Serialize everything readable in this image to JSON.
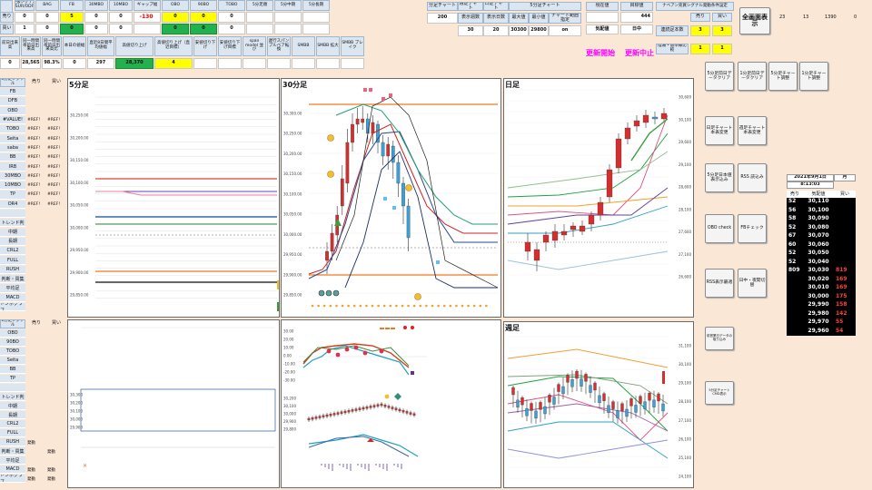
{
  "top_headers": [
    {
      "label": "逆張シグナル（SUR/ODF）",
      "value": "0",
      "hl": "val"
    },
    {
      "label": "BAG",
      "value": "0",
      "hl": "val"
    },
    {
      "label": "FB",
      "value": "5",
      "hl": "yel"
    },
    {
      "label": "30MBO",
      "value": "0",
      "hl": "val"
    },
    {
      "label": "10MBO",
      "value": "0",
      "hl": "val"
    },
    {
      "label": "ギャップ幅",
      "value": "-130",
      "hl": "red"
    },
    {
      "label": "OBO",
      "value": "0",
      "hl": "yel"
    },
    {
      "label": "90BO",
      "value": "0",
      "hl": "yel"
    },
    {
      "label": "TOBO",
      "value": "0",
      "hl": "val"
    },
    {
      "label": "5分足順",
      "value": "",
      "hl": "val"
    },
    {
      "label": "5分中期",
      "value": "",
      "hl": "val"
    },
    {
      "label": "5分長期",
      "value": "",
      "hl": "val"
    }
  ],
  "row1": {
    "label": "売り",
    "values": [
      "0",
      "0",
      "5",
      "0",
      "0",
      "",
      "0",
      "0",
      "0",
      "",
      "",
      ""
    ]
  },
  "row2": {
    "label": "買い",
    "values": [
      "1",
      "0",
      "0",
      "0",
      "0",
      "",
      "0",
      "0",
      "0",
      "",
      "",
      ""
    ]
  },
  "row3": [
    {
      "label": "前日出来高",
      "value": "0"
    },
    {
      "label": "同一時間帯前日出来高",
      "value": "28,565"
    },
    {
      "label": "同一時間帯前日出来高比",
      "value": "98.3%"
    },
    {
      "label": "本日の値幅",
      "value": "0"
    },
    {
      "label": "直近8日間平均値幅",
      "value": "297"
    },
    {
      "label": "高値切り上げ",
      "value": "28,370"
    },
    {
      "label": "高値切り上げ（直近目標）",
      "value": "4"
    },
    {
      "label": "安値切り下げ",
      "value": ""
    },
    {
      "label": "安値切り下げ目標",
      "value": ""
    },
    {
      "label": "span model 並び",
      "value": ""
    },
    {
      "label": "遅行スパン ブルベア転換",
      "value": ""
    },
    {
      "label": "SMBB",
      "value": ""
    },
    {
      "label": "SMBB 拡大",
      "value": ""
    },
    {
      "label": "SMBB ブレイク",
      "value": ""
    }
  ],
  "chart_settings": {
    "headers": [
      "分足チャート",
      "週足チャート",
      "日足チャート",
      "",
      "5分足チャート"
    ],
    "row1": [
      "200",
      "表示週数",
      "表示日数",
      "最大値",
      "最小値",
      "チャート範囲指定"
    ],
    "row2": [
      "",
      "30",
      "20",
      "30300",
      "29800",
      "on"
    ]
  },
  "status": {
    "current_price_label": "現在値",
    "current_price": "",
    "target_label": "目標値",
    "target": "444",
    "mode_label": "気配値",
    "session_label": "日中"
  },
  "signal_settings": {
    "title": "ナベアン売買シグナル発動条件設定",
    "cols": [
      "売り",
      "買い"
    ],
    "rows": [
      {
        "label": "連続足本数",
        "sell": "3",
        "buy": "3"
      },
      {
        "label": "陰陽・基準線比較",
        "sell": "1",
        "buy": "1"
      }
    ]
  },
  "update_buttons": {
    "start": "更新開始",
    "stop": "更新中止"
  },
  "full_screen": "全画面表示",
  "top_right_values": [
    "23",
    "13",
    "1390",
    "0"
  ],
  "left_list1": {
    "title": "5分足シグナル",
    "cols": [
      "売り",
      "買い"
    ],
    "rows": [
      {
        "label": "FB",
        "sell": "",
        "buy": ""
      },
      {
        "label": "DFB",
        "sell": "",
        "buy": ""
      },
      {
        "label": "OBO",
        "sell": "",
        "buy": ""
      },
      {
        "label": "#VALUE!",
        "sell": "#REF!",
        "buy": "#REF!"
      },
      {
        "label": "TOBO",
        "sell": "#REF!",
        "buy": "#REF!"
      },
      {
        "label": "Seita",
        "sell": "#REF!",
        "buy": "#REF!"
      },
      {
        "label": "saba",
        "sell": "#REF!",
        "buy": "#REF!"
      },
      {
        "label": "BB",
        "sell": "#REF!",
        "buy": "#REF!"
      },
      {
        "label": "IRB",
        "sell": "#REF!",
        "buy": "#REF!"
      },
      {
        "label": "30MBO",
        "sell": "#REF!",
        "buy": "#REF!"
      },
      {
        "label": "10MBO",
        "sell": "#REF!",
        "buy": "#REF!"
      },
      {
        "label": "TP",
        "sell": "#REF!",
        "buy": "#REF!"
      },
      {
        "label": "OR4",
        "sell": "#REF!",
        "buy": "#REF!"
      },
      {
        "label": "",
        "sell": "",
        "buy": ""
      },
      {
        "label": "トレンド判",
        "sell": "",
        "buy": ""
      },
      {
        "label": "中期",
        "sell": "",
        "buy": ""
      },
      {
        "label": "長期",
        "sell": "",
        "buy": ""
      },
      {
        "label": "CRL2",
        "sell": "",
        "buy": ""
      },
      {
        "label": "FULL",
        "sell": "",
        "buy": ""
      },
      {
        "label": "RUSH",
        "sell": "",
        "buy": ""
      },
      {
        "label": "判断・買集",
        "sell": "",
        "buy": ""
      },
      {
        "label": "平均足",
        "sell": "",
        "buy": ""
      },
      {
        "label": "MACD",
        "sell": "",
        "buy": ""
      },
      {
        "label": "トンボグラフ",
        "sell": "",
        "buy": ""
      }
    ]
  },
  "left_list2": {
    "title": "1分足シグナル",
    "cols": [
      "売り",
      "買い"
    ],
    "rows": [
      {
        "label": "OBO",
        "sell": "",
        "buy": ""
      },
      {
        "label": "90BO",
        "sell": "",
        "buy": ""
      },
      {
        "label": "TOBO",
        "sell": "",
        "buy": ""
      },
      {
        "label": "Seita",
        "sell": "",
        "buy": ""
      },
      {
        "label": "BB",
        "sell": "",
        "buy": ""
      },
      {
        "label": "TP",
        "sell": "",
        "buy": ""
      },
      {
        "label": "",
        "sell": "",
        "buy": ""
      },
      {
        "label": "トレンド判",
        "sell": "",
        "buy": ""
      },
      {
        "label": "中期",
        "sell": "",
        "buy": ""
      },
      {
        "label": "長期",
        "sell": "",
        "buy": ""
      },
      {
        "label": "CRL2",
        "sell": "",
        "buy": ""
      },
      {
        "label": "FULL",
        "sell": "",
        "buy": ""
      },
      {
        "label": "RUSH",
        "sell": "発動",
        "buy": ""
      },
      {
        "label": "判断・買集",
        "sell": "",
        "buy": "発動"
      },
      {
        "label": "平均足",
        "sell": "",
        "buy": ""
      },
      {
        "label": "MACD",
        "sell": "発動",
        "buy": "発動"
      },
      {
        "label": "トンボグラフ",
        "sell": "発動",
        "buy": "発動"
      }
    ]
  },
  "chart5": {
    "title": "5分足",
    "ticks": [
      "30,250.00",
      "30,200.00",
      "30,150.00",
      "30,100.00",
      "30,050.00",
      "30,000.00",
      "29,950.00",
      "29,900.00",
      "29,850.00"
    ]
  },
  "chart30": {
    "title": "30分足",
    "ticks": [
      "30,300.00",
      "30,250.00",
      "30,200.00",
      "30,150.00",
      "30,100.00",
      "30,050.00",
      "30,000.00",
      "29,950.00",
      "29,900.00",
      "29,850.00"
    ]
  },
  "chartD": {
    "title": "日足",
    "ticks": [
      "30,600",
      "30,100",
      "29,600",
      "29,100",
      "28,600",
      "28,100",
      "27,600",
      "27,100",
      "26,600"
    ]
  },
  "chartW": {
    "title": "週足",
    "ticks": [
      "31,100",
      "30,100",
      "29,100",
      "28,100",
      "27,100",
      "26,100",
      "25,100",
      "24,100"
    ]
  },
  "sub_ticks30": [
    "30.00",
    "20.00",
    "10.00",
    "0.00",
    "-10.00",
    "-20.00",
    "-30.00"
  ],
  "sub_ticks30b": [
    "30,200",
    "30,100",
    "30,000",
    "29,900",
    "29,800"
  ],
  "sub_ticks5": [
    "30,300",
    "30,200",
    "30,100",
    "30,000",
    "29,900"
  ],
  "right_buttons": [
    "5分足前日データクリア",
    "1分足前日データクリア",
    "5分足チャート調整",
    "1分足チャート調整",
    "日足チャート本表変更",
    "週足チャート本表変更",
    "5分足日本値表示込み",
    "RSS 読込み",
    "OBO check",
    "FBチェック",
    "RSS表示最適",
    "日中・夜間切替",
    "前営業日データの取り込み",
    "5分足チャートCMD表示"
  ],
  "orderbook": {
    "date": "2021年9月1日",
    "day": "月",
    "time": "8:13:03",
    "cols": [
      "売り",
      "気配値",
      "買い"
    ],
    "rows": [
      {
        "sell": "52",
        "price": "30,110",
        "buy": ""
      },
      {
        "sell": "56",
        "price": "30,100",
        "buy": ""
      },
      {
        "sell": "58",
        "price": "30,090",
        "buy": ""
      },
      {
        "sell": "52",
        "price": "30,080",
        "buy": ""
      },
      {
        "sell": "67",
        "price": "30,070",
        "buy": ""
      },
      {
        "sell": "60",
        "price": "30,060",
        "buy": ""
      },
      {
        "sell": "52",
        "price": "30,050",
        "buy": ""
      },
      {
        "sell": "52",
        "price": "30,040",
        "buy": ""
      },
      {
        "sell": "809",
        "price": "30,030",
        "buy": "819"
      },
      {
        "sell": "",
        "price": "30,020",
        "buy": "169"
      },
      {
        "sell": "",
        "price": "30,010",
        "buy": "169"
      },
      {
        "sell": "",
        "price": "30,000",
        "buy": "175"
      },
      {
        "sell": "",
        "price": "29,990",
        "buy": "158"
      },
      {
        "sell": "",
        "price": "29,980",
        "buy": "142"
      },
      {
        "sell": "",
        "price": "29,970",
        "buy": "55"
      },
      {
        "sell": "",
        "price": "29,960",
        "buy": "54"
      }
    ]
  },
  "colors": {
    "accent_pink": "#ff00ff",
    "yellow": "#ffff00",
    "green": "#22b14c",
    "header_blue": "#dce6f1"
  }
}
